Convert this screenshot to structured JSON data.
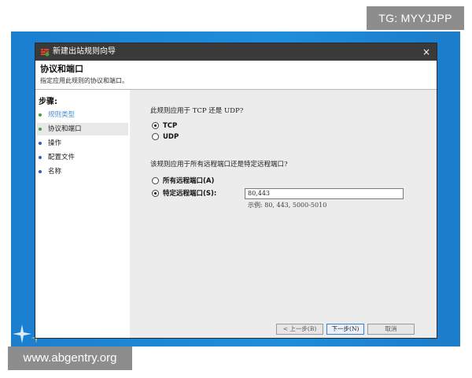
{
  "watermarks": {
    "top": "TG: MYYJJPP",
    "bottom": "www.abgentry.org"
  },
  "window": {
    "title": "新建出站规则向导",
    "close_symbol": "×"
  },
  "header": {
    "title": "协议和端口",
    "subtitle": "指定应用此规则的协议和端口。"
  },
  "steps": {
    "label": "步骤:",
    "items": [
      {
        "label": "规则类型",
        "state": "done"
      },
      {
        "label": "协议和端口",
        "state": "current"
      },
      {
        "label": "操作",
        "state": "pending"
      },
      {
        "label": "配置文件",
        "state": "pending"
      },
      {
        "label": "名称",
        "state": "pending"
      }
    ]
  },
  "protocol": {
    "question": "此规则应用于 TCP 还是 UDP?",
    "options": [
      {
        "label": "TCP",
        "checked": true
      },
      {
        "label": "UDP",
        "checked": false
      }
    ]
  },
  "ports": {
    "question": "该规则应用于所有远程端口还是特定远程端口?",
    "options": [
      {
        "label": "所有远程端口(A)",
        "checked": false
      },
      {
        "label": "特定远程端口(S):",
        "checked": true
      }
    ],
    "value": "80,443",
    "example": "示例: 80, 443, 5000-5010"
  },
  "buttons": {
    "back": "< 上一步(B)",
    "next": "下一步(N)",
    "cancel": "取消"
  },
  "colors": {
    "titlebar": "#3a3a3a",
    "desktop": "#1f8ddd",
    "step_done_dot": "#3aa33a",
    "step_current_dot": "#3aa33a",
    "step_pending_dot": "#2b5fb4",
    "content_bg": "#ececec"
  }
}
